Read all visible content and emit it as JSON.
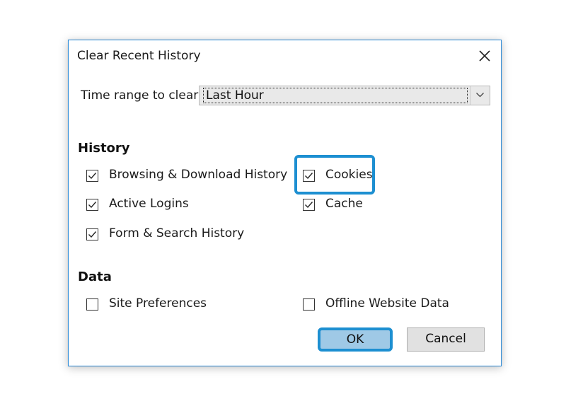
{
  "dialog": {
    "title": "Clear Recent History",
    "close_icon": "close-icon"
  },
  "time_range": {
    "label": "Time range to clear:",
    "selected": "Last Hour"
  },
  "history": {
    "heading": "History",
    "items": [
      {
        "label": "Browsing & Download History",
        "checked": true
      },
      {
        "label": "Active Logins",
        "checked": true
      },
      {
        "label": "Form & Search History",
        "checked": true
      },
      {
        "label": "Cookies",
        "checked": true
      },
      {
        "label": "Cache",
        "checked": true
      }
    ]
  },
  "data": {
    "heading": "Data",
    "items": [
      {
        "label": "Site Preferences",
        "checked": false
      },
      {
        "label": "Offline Website Data",
        "checked": false
      }
    ]
  },
  "buttons": {
    "ok": "OK",
    "cancel": "Cancel"
  },
  "colors": {
    "accent": "#1d8fd1",
    "ok_fill": "#9fc9e6"
  }
}
